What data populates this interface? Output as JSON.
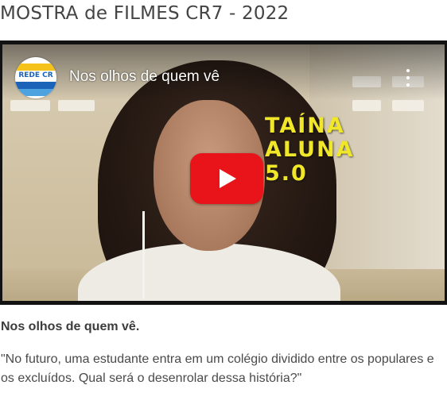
{
  "page": {
    "title": "MOSTRA de FILMES CR7 - 2022"
  },
  "video": {
    "title": "Nos olhos de quem vê",
    "channel_logo_text": "REDE CR",
    "overlay_lines": [
      "TAÍNA",
      "ALUNA",
      "5.0"
    ],
    "play_icon": "youtube-play-icon",
    "more_icon": "vertical-ellipsis-icon"
  },
  "caption": {
    "title": "Nos olhos de quem vê.",
    "description": "\"No futuro, uma estudante entra em um colégio dividido entre os populares e os excluídos. Qual será o desenrolar dessa história?\""
  },
  "colors": {
    "play_button": "#e8141a",
    "overlay_text": "#f0e62a",
    "title_text": "#444444",
    "logo_blue": "#1b63b8",
    "logo_yellow": "#f4c21a"
  }
}
